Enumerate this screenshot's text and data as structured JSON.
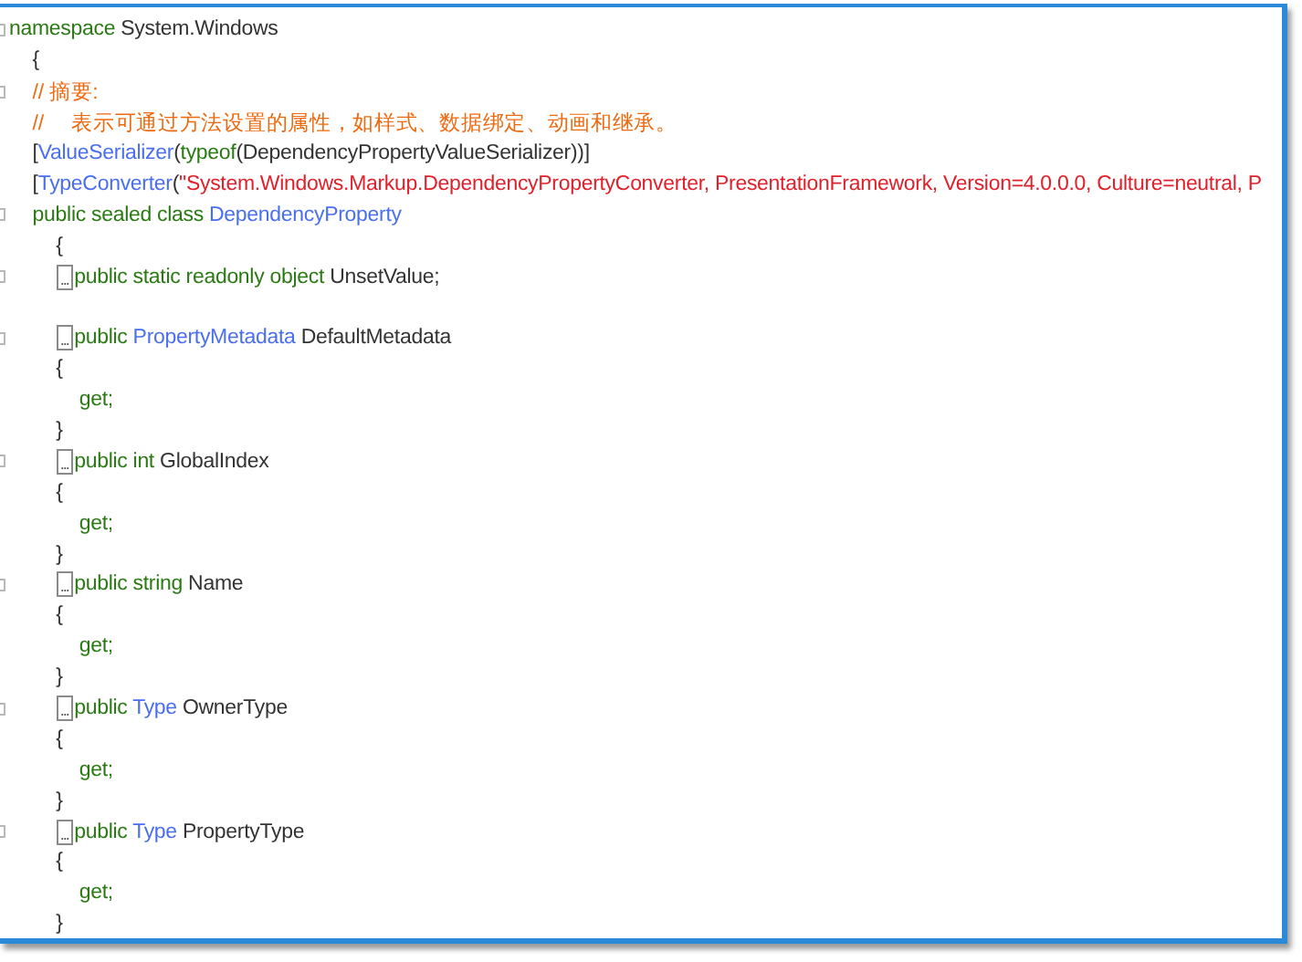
{
  "code_lines": [
    {
      "kind": "code",
      "outline": true,
      "tokens": [
        {
          "kind": "keyword",
          "text": "namespace"
        },
        {
          "kind": "plain",
          "text": " System.Windows"
        }
      ],
      "children": [
        {
          "kind": "code",
          "outline": false,
          "tokens": [
            {
              "kind": "plain",
              "text": "{"
            }
          ]
        },
        {
          "kind": "code",
          "outline": true,
          "tokens": [
            {
              "kind": "comment",
              "text": "// 摘要:"
            }
          ]
        },
        {
          "kind": "code",
          "outline": false,
          "tokens": [
            {
              "kind": "comment",
              "text": "//     表示可通过方法设置的属性，如样式、数据绑定、动画和继承。"
            }
          ]
        },
        {
          "kind": "code",
          "outline": false,
          "tokens": [
            {
              "kind": "plain",
              "text": "["
            },
            {
              "kind": "type",
              "text": "ValueSerializer"
            },
            {
              "kind": "plain",
              "text": "("
            },
            {
              "kind": "keyword",
              "text": "typeof"
            },
            {
              "kind": "plain",
              "text": "(DependencyPropertyValueSerializer))]"
            }
          ]
        },
        {
          "kind": "code",
          "outline": false,
          "tokens": [
            {
              "kind": "plain",
              "text": "["
            },
            {
              "kind": "type",
              "text": "TypeConverter"
            },
            {
              "kind": "plain",
              "text": "("
            },
            {
              "kind": "string",
              "text": "\"System.Windows.Markup.DependencyPropertyConverter, PresentationFramework, Version=4.0.0.0, Culture=neutral, P"
            }
          ]
        },
        {
          "kind": "code",
          "outline": true,
          "tokens": [
            {
              "kind": "keyword",
              "text": "public sealed class "
            },
            {
              "kind": "type",
              "text": "DependencyProperty"
            }
          ],
          "children": [
            {
              "kind": "code",
              "outline": false,
              "tokens": [
                {
                  "kind": "plain",
                  "text": "{"
                }
              ]
            },
            {
              "kind": "code",
              "outline": true,
              "fold": "...",
              "tokens": [
                {
                  "kind": "keyword",
                  "text": "public static readonly object"
                },
                {
                  "kind": "plain",
                  "text": " UnsetValue;"
                }
              ]
            },
            {
              "kind": "blank"
            },
            {
              "kind": "code",
              "outline": true,
              "fold": "...",
              "tokens": [
                {
                  "kind": "keyword",
                  "text": "public "
                },
                {
                  "kind": "type",
                  "text": "PropertyMetadata"
                },
                {
                  "kind": "plain",
                  "text": " DefaultMetadata"
                }
              ]
            },
            {
              "kind": "code",
              "outline": false,
              "tokens": [
                {
                  "kind": "plain",
                  "text": "{"
                }
              ],
              "children": [
                {
                  "kind": "code",
                  "outline": false,
                  "tokens": [
                    {
                      "kind": "keyword",
                      "text": "get;"
                    }
                  ]
                }
              ]
            },
            {
              "kind": "code",
              "outline": false,
              "tokens": [
                {
                  "kind": "plain",
                  "text": "}"
                }
              ]
            },
            {
              "kind": "code",
              "outline": true,
              "fold": "...",
              "tokens": [
                {
                  "kind": "keyword",
                  "text": "public int"
                },
                {
                  "kind": "plain",
                  "text": " GlobalIndex"
                }
              ]
            },
            {
              "kind": "code",
              "outline": false,
              "tokens": [
                {
                  "kind": "plain",
                  "text": "{"
                }
              ],
              "children": [
                {
                  "kind": "code",
                  "outline": false,
                  "tokens": [
                    {
                      "kind": "keyword",
                      "text": "get;"
                    }
                  ]
                }
              ]
            },
            {
              "kind": "code",
              "outline": false,
              "tokens": [
                {
                  "kind": "plain",
                  "text": "}"
                }
              ]
            },
            {
              "kind": "code",
              "outline": true,
              "fold": "...",
              "tokens": [
                {
                  "kind": "keyword",
                  "text": "public string"
                },
                {
                  "kind": "plain",
                  "text": " Name"
                }
              ]
            },
            {
              "kind": "code",
              "outline": false,
              "tokens": [
                {
                  "kind": "plain",
                  "text": "{"
                }
              ],
              "children": [
                {
                  "kind": "code",
                  "outline": false,
                  "tokens": [
                    {
                      "kind": "keyword",
                      "text": "get;"
                    }
                  ]
                }
              ]
            },
            {
              "kind": "code",
              "outline": false,
              "tokens": [
                {
                  "kind": "plain",
                  "text": "}"
                }
              ]
            },
            {
              "kind": "code",
              "outline": true,
              "fold": "...",
              "tokens": [
                {
                  "kind": "keyword",
                  "text": "public "
                },
                {
                  "kind": "type",
                  "text": "Type"
                },
                {
                  "kind": "plain",
                  "text": " OwnerType"
                }
              ]
            },
            {
              "kind": "code",
              "outline": false,
              "tokens": [
                {
                  "kind": "plain",
                  "text": "{"
                }
              ],
              "children": [
                {
                  "kind": "code",
                  "outline": false,
                  "tokens": [
                    {
                      "kind": "keyword",
                      "text": "get;"
                    }
                  ]
                }
              ]
            },
            {
              "kind": "code",
              "outline": false,
              "tokens": [
                {
                  "kind": "plain",
                  "text": "}"
                }
              ]
            },
            {
              "kind": "code",
              "outline": true,
              "fold": "...",
              "tokens": [
                {
                  "kind": "keyword",
                  "text": "public "
                },
                {
                  "kind": "type",
                  "text": "Type"
                },
                {
                  "kind": "plain",
                  "text": " PropertyType"
                }
              ]
            },
            {
              "kind": "code",
              "outline": false,
              "tokens": [
                {
                  "kind": "plain",
                  "text": "{"
                }
              ],
              "children": [
                {
                  "kind": "code",
                  "outline": false,
                  "tokens": [
                    {
                      "kind": "keyword",
                      "text": "get;"
                    }
                  ]
                }
              ]
            },
            {
              "kind": "code",
              "outline": false,
              "tokens": [
                {
                  "kind": "plain",
                  "text": "}"
                }
              ]
            }
          ]
        }
      ]
    }
  ]
}
